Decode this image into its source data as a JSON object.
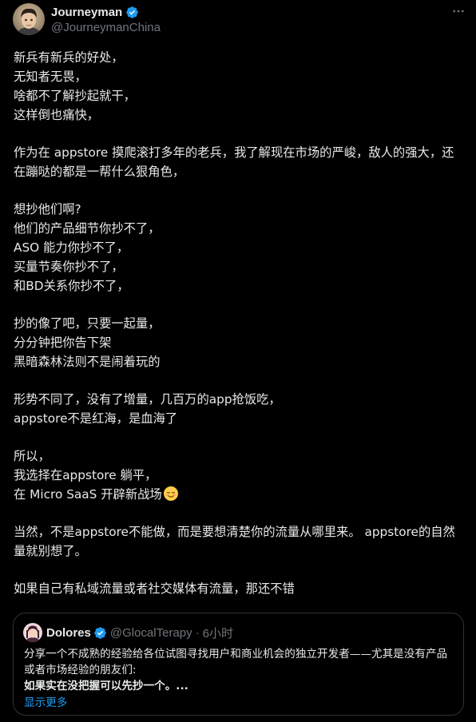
{
  "author": {
    "display_name": "Journeyman",
    "handle": "@JourneymanChina",
    "verified": true
  },
  "menu_icon": "more-horizontal-icon",
  "body_paragraphs": [
    [
      "新兵有新兵的好处，",
      "无知者无畏，",
      "啥都不了解抄起就干，",
      "这样倒也痛快，"
    ],
    [
      "作为在 appstore 摸爬滚打多年的老兵，我了解现在市场的严峻，敌人的强大，还在蹦哒的都是一帮什么狠角色，"
    ],
    [
      "想抄他们啊?",
      "他们的产品细节你抄不了，",
      "ASO 能力你抄不了，",
      "买量节奏你抄不了，",
      "和BD关系你抄不了，"
    ],
    [
      "抄的像了吧，只要一起量，",
      "分分钟把你告下架",
      "黑暗森林法则不是闹着玩的"
    ],
    [
      "形势不同了，没有了增量，几百万的app抢饭吃，",
      "appstore不是红海，是血海了"
    ],
    [
      "所以，",
      "我选择在appstore 躺平，",
      "在 Micro SaaS 开辟新战场"
    ],
    [
      "当然，不是appstore不能做，而是要想清楚你的流量从哪里来。 appstore的自然量就别想了。"
    ],
    [
      "如果自己有私域流量或者社交媒体有流量，那还不错"
    ]
  ],
  "emoji": "relieved-face-emoji",
  "quote": {
    "display_name": "Dolores",
    "verified": true,
    "handle": "@GlocalTerapy",
    "separator": "·",
    "time": "6小时",
    "text": "分享一个不成熟的经验给各位试图寻找用户和商业机会的独立开发者——尤其是没有产品或者市场经验的朋友们:",
    "bold_text": "如果实在没把握可以先抄一个。...",
    "show_more": "显示更多"
  },
  "colors": {
    "background": "#000000",
    "text": "#e7e9ea",
    "secondary": "#71767b",
    "accent": "#1d9bf0",
    "border": "#2f3336"
  }
}
